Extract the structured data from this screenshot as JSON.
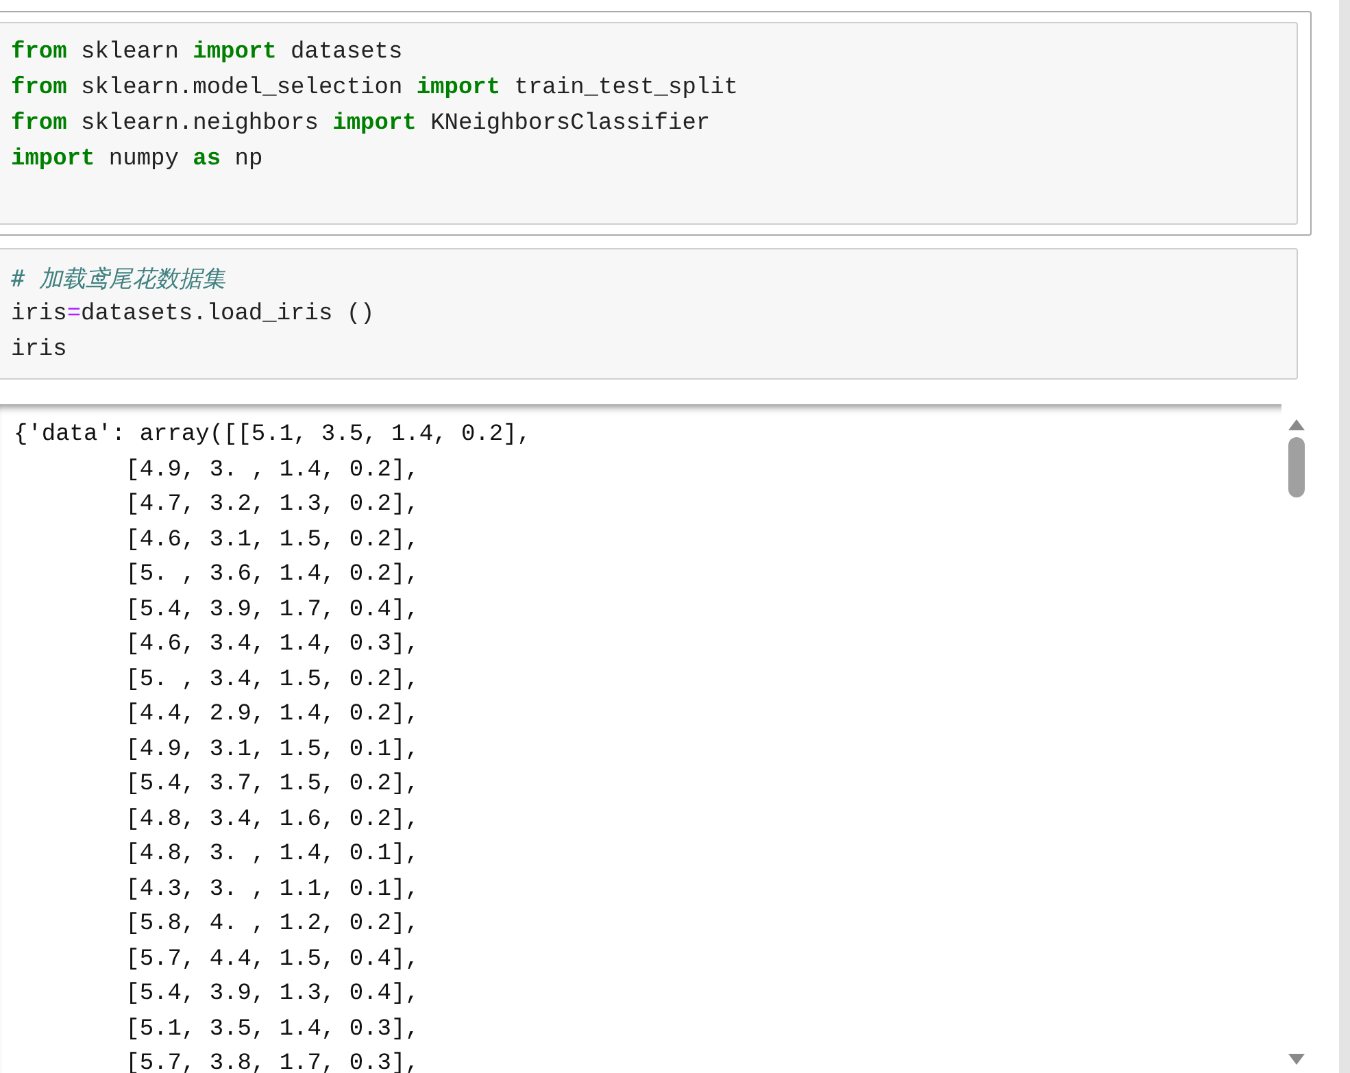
{
  "cells": [
    {
      "selected": true,
      "lines": [
        [
          {
            "kind": "keyword",
            "text": "from"
          },
          {
            "kind": "plain",
            "text": " sklearn "
          },
          {
            "kind": "keyword",
            "text": "import"
          },
          {
            "kind": "plain",
            "text": " datasets"
          }
        ],
        [
          {
            "kind": "keyword",
            "text": "from"
          },
          {
            "kind": "plain",
            "text": " sklearn.model_selection "
          },
          {
            "kind": "keyword",
            "text": "import"
          },
          {
            "kind": "plain",
            "text": " train_test_split"
          }
        ],
        [
          {
            "kind": "keyword",
            "text": "from"
          },
          {
            "kind": "plain",
            "text": " sklearn.neighbors "
          },
          {
            "kind": "keyword",
            "text": "import"
          },
          {
            "kind": "plain",
            "text": " KNeighborsClassifier"
          }
        ],
        [
          {
            "kind": "keyword",
            "text": "import"
          },
          {
            "kind": "plain",
            "text": " numpy "
          },
          {
            "kind": "keyword",
            "text": "as"
          },
          {
            "kind": "plain",
            "text": " np"
          }
        ]
      ]
    },
    {
      "selected": false,
      "lines": [
        [
          {
            "kind": "comment",
            "text": "# 加载鸢尾花数据集"
          }
        ],
        [
          {
            "kind": "plain",
            "text": "iris"
          },
          {
            "kind": "operator",
            "text": "="
          },
          {
            "kind": "plain",
            "text": "datasets.load_iris ()"
          }
        ],
        [
          {
            "kind": "plain",
            "text": "iris"
          }
        ]
      ],
      "output": [
        "{'data': array([[5.1, 3.5, 1.4, 0.2],",
        "        [4.9, 3. , 1.4, 0.2],",
        "        [4.7, 3.2, 1.3, 0.2],",
        "        [4.6, 3.1, 1.5, 0.2],",
        "        [5. , 3.6, 1.4, 0.2],",
        "        [5.4, 3.9, 1.7, 0.4],",
        "        [4.6, 3.4, 1.4, 0.3],",
        "        [5. , 3.4, 1.5, 0.2],",
        "        [4.4, 2.9, 1.4, 0.2],",
        "        [4.9, 3.1, 1.5, 0.1],",
        "        [5.4, 3.7, 1.5, 0.2],",
        "        [4.8, 3.4, 1.6, 0.2],",
        "        [4.8, 3. , 1.4, 0.1],",
        "        [4.3, 3. , 1.1, 0.1],",
        "        [5.8, 4. , 1.2, 0.2],",
        "        [5.7, 4.4, 1.5, 0.4],",
        "        [5.4, 3.9, 1.3, 0.4],",
        "        [5.1, 3.5, 1.4, 0.3],",
        "        [5.7, 3.8, 1.7, 0.3],"
      ]
    }
  ]
}
